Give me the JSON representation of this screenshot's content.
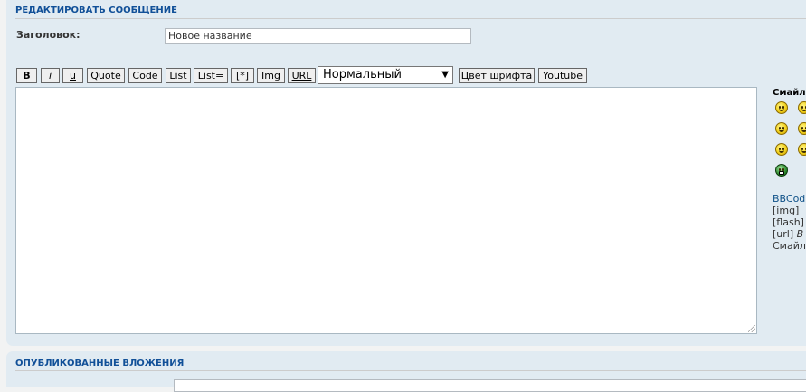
{
  "section": {
    "title": "Редактировать сообщение"
  },
  "subject": {
    "label": "Заголовок:",
    "value": "Новое название"
  },
  "toolbar": {
    "bold": "B",
    "italic": "i",
    "underline": "u",
    "quote": "Quote",
    "code": "Code",
    "list": "List",
    "list_eq": "List=",
    "list_item": "[*]",
    "img": "Img",
    "url": "URL",
    "font_size": "Нормальный",
    "font_color": "Цвет шрифта",
    "youtube": "Youtube"
  },
  "smilies": {
    "title": "Смайл",
    "icons": [
      "smile-icon",
      "smile-icon",
      "smile-icon",
      "smile-icon",
      "smile-icon",
      "smile-icon",
      "grin-icon"
    ]
  },
  "bbcode_info": {
    "line1": "BBCod",
    "line2_tag": "[img]",
    "line3_tag": "[flash]",
    "line4_tag": "[url]",
    "line4_rest": "В",
    "line5": "Смайл"
  },
  "attachments": {
    "title": "Опубликованные вложения"
  }
}
